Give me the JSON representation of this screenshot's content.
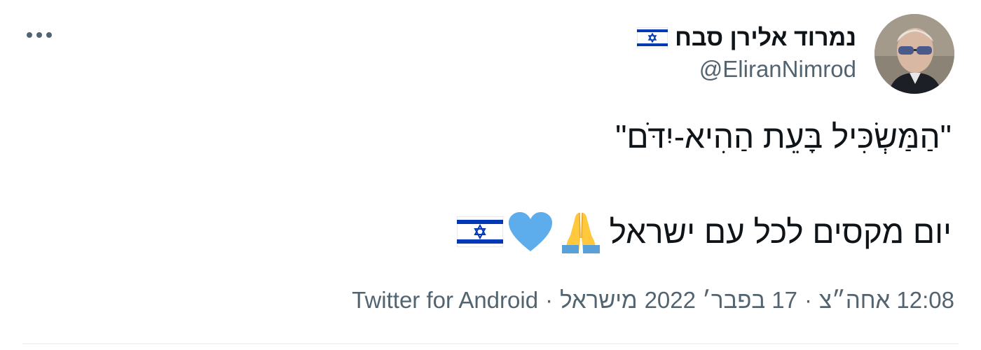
{
  "tweet": {
    "author": {
      "display_name": "נמרוד אלירן סבח",
      "handle": "@EliranNimrod",
      "name_flag": "israel-flag-icon"
    },
    "menu_icon": "more-options-icon",
    "text_line1": "\"הַמַּשְׂכִּיל בָּעֵת הַהִיא-יִדֹּם\"",
    "text_line2": "יום מקסים לכל עם ישראל",
    "emojis": [
      "folded-hands-icon",
      "blue-heart-icon",
      "israel-flag-icon"
    ],
    "meta": {
      "time": "12:08 אחה״צ",
      "date": "17 בפבר׳ 2022",
      "location": "מישראל",
      "source": "Twitter for Android",
      "separator": "·"
    }
  },
  "colors": {
    "text_primary": "#0f1419",
    "text_secondary": "#536471",
    "divider": "#eff3f4",
    "heart_blue": "#5dadec",
    "flag_blue": "#0038b8"
  }
}
